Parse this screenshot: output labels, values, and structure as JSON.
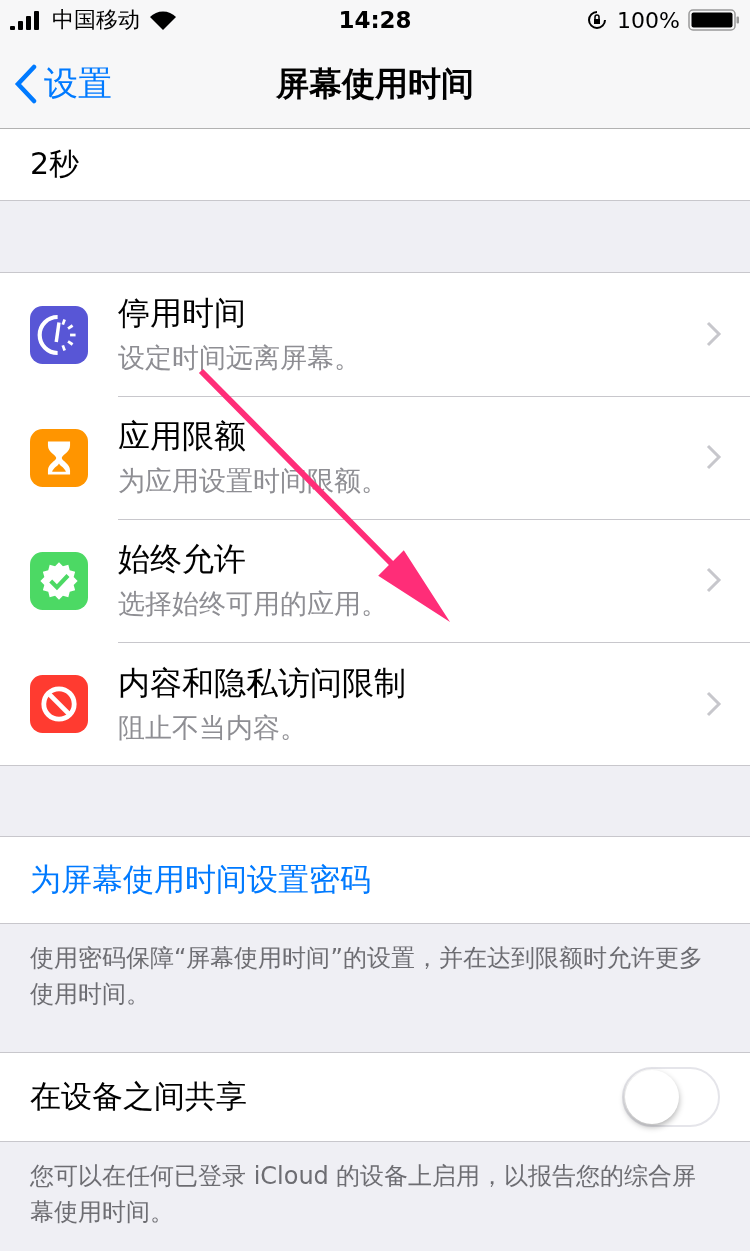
{
  "status_bar": {
    "carrier": "中国移动",
    "time": "14:28",
    "battery": "100%"
  },
  "nav": {
    "back": "设置",
    "title": "屏幕使用时间"
  },
  "top_cell": {
    "value": "2秒"
  },
  "features": [
    {
      "title": "停用时间",
      "subtitle": "设定时间远离屏幕。",
      "color": "#5856d6"
    },
    {
      "title": "应用限额",
      "subtitle": "为应用设置时间限额。",
      "color": "#ff9500"
    },
    {
      "title": "始终允许",
      "subtitle": "选择始终可用的应用。",
      "color": "#4cd964"
    },
    {
      "title": "内容和隐私访问限制",
      "subtitle": "阻止不当内容。",
      "color": "#ff3b30"
    }
  ],
  "passcode": {
    "link": "为屏幕使用时间设置密码",
    "footer": "使用密码保障“屏幕使用时间”的设置，并在达到限额时允许更多使用时间。"
  },
  "share": {
    "label": "在设备之间共享",
    "on": false,
    "footer": "您可以在任何已登录 iCloud 的设备上启用，以报告您的综合屏幕使用时间。"
  }
}
